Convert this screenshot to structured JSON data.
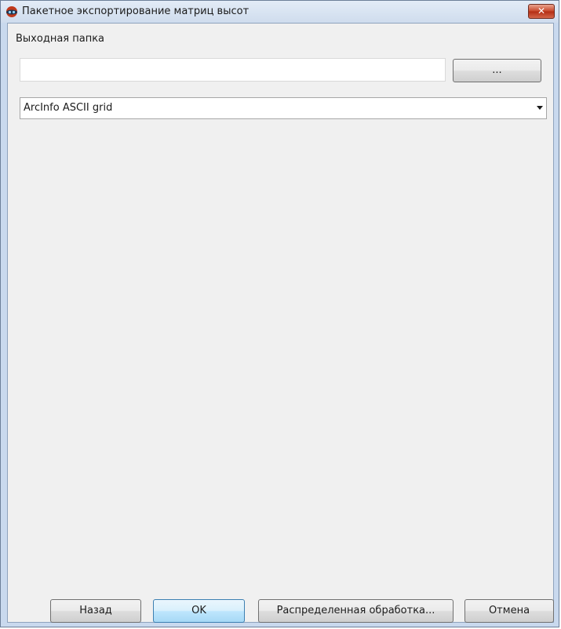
{
  "window": {
    "title": "Пакетное экспортирование матриц высот",
    "close_glyph": "✕"
  },
  "output_folder": {
    "label": "Выходная папка",
    "value": "",
    "browse_label": "..."
  },
  "format": {
    "selected": "ArcInfo ASCII grid"
  },
  "buttons": {
    "back": "Назад",
    "ok": "OK",
    "distributed": "Распределенная обработка...",
    "cancel": "Отмена"
  },
  "colors": {
    "titlebar": "#dbe6f4",
    "client_background": "#f0f0f0",
    "close_button": "#c8482c",
    "default_button_border": "#3c7fb1"
  },
  "icons": {
    "app": "app-logo-icon",
    "close": "close-icon",
    "dropdown": "chevron-down-icon"
  }
}
